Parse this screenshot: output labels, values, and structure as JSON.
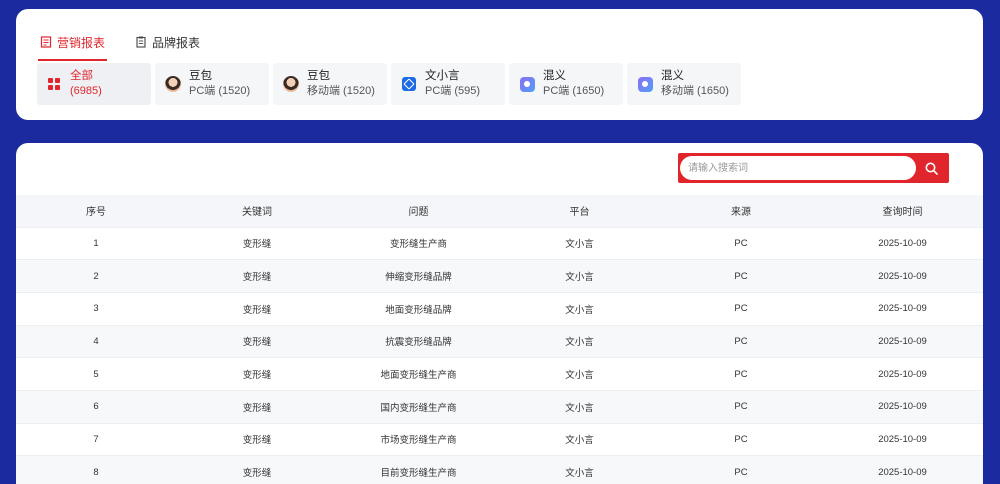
{
  "tabs": [
    {
      "label": "营销报表",
      "active": true,
      "icon": "report-icon"
    },
    {
      "label": "品牌报表",
      "active": false,
      "icon": "clipboard-icon"
    }
  ],
  "filters": [
    {
      "name": "全部",
      "sub": "(6985)",
      "icon": "grid-icon",
      "active": true
    },
    {
      "name": "豆包",
      "sub": "PC端 (1520)",
      "icon": "doubao-avatar-icon"
    },
    {
      "name": "豆包",
      "sub": "移动端 (1520)",
      "icon": "doubao-avatar-icon"
    },
    {
      "name": "文小言",
      "sub": "PC端 (595)",
      "icon": "wenxiaoyan-icon"
    },
    {
      "name": "混义",
      "sub": "PC端 (1650)",
      "icon": "hunyuan-icon"
    },
    {
      "name": "混义",
      "sub": "移动端 (1650)",
      "icon": "hunyuan-icon"
    }
  ],
  "search": {
    "placeholder": "请输入搜索词",
    "button_icon": "search-icon"
  },
  "table": {
    "headers": [
      "序号",
      "关键词",
      "问题",
      "平台",
      "来源",
      "查询时间"
    ],
    "rows": [
      [
        "1",
        "变形缝",
        "变形缝生产商",
        "文小言",
        "PC",
        "2025-10-09"
      ],
      [
        "2",
        "变形缝",
        "伸缩变形缝品牌",
        "文小言",
        "PC",
        "2025-10-09"
      ],
      [
        "3",
        "变形缝",
        "地面变形缝品牌",
        "文小言",
        "PC",
        "2025-10-09"
      ],
      [
        "4",
        "变形缝",
        "抗震变形缝品牌",
        "文小言",
        "PC",
        "2025-10-09"
      ],
      [
        "5",
        "变形缝",
        "地面变形缝生产商",
        "文小言",
        "PC",
        "2025-10-09"
      ],
      [
        "6",
        "变形缝",
        "国内变形缝生产商",
        "文小言",
        "PC",
        "2025-10-09"
      ],
      [
        "7",
        "变形缝",
        "市场变形缝生产商",
        "文小言",
        "PC",
        "2025-10-09"
      ],
      [
        "8",
        "变形缝",
        "目前变形缝生产商",
        "文小言",
        "PC",
        "2025-10-09"
      ]
    ]
  },
  "colors": {
    "accent": "#e0262c",
    "page_bg": "#1b2a9f"
  }
}
